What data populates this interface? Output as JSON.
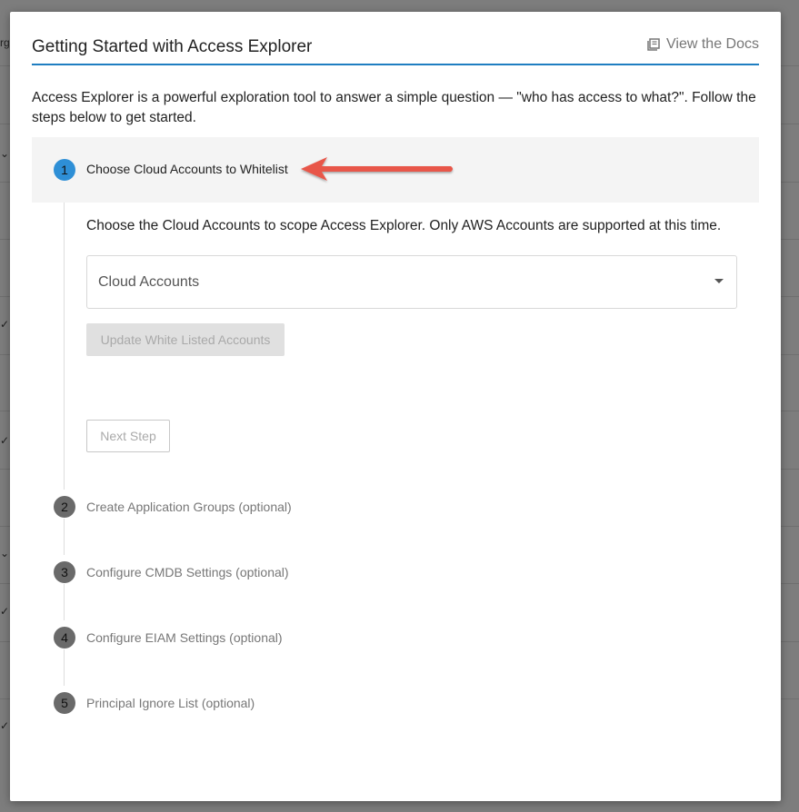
{
  "modal": {
    "title": "Getting Started with Access Explorer",
    "docs_link": "View the Docs",
    "intro": "Access Explorer is a powerful exploration tool to answer a simple question — \"who has access to what?\". Follow the steps below to get started."
  },
  "steps": [
    {
      "number": "1",
      "label": "Choose Cloud Accounts to Whitelist",
      "active": true
    },
    {
      "number": "2",
      "label": "Create Application Groups (optional)",
      "active": false
    },
    {
      "number": "3",
      "label": "Configure CMDB Settings (optional)",
      "active": false
    },
    {
      "number": "4",
      "label": "Configure EIAM Settings (optional)",
      "active": false
    },
    {
      "number": "5",
      "label": "Principal Ignore List (optional)",
      "active": false
    }
  ],
  "step1": {
    "description": "Choose the Cloud Accounts to scope Access Explorer. Only AWS Accounts are supported at this time.",
    "select_placeholder": "Cloud Accounts",
    "update_button": "Update White Listed Accounts",
    "next_button": "Next Step"
  },
  "background": {
    "fragment": "rg"
  },
  "colors": {
    "accent": "#1f7ec1",
    "active_step": "#2e8fd6",
    "inactive_step": "#6a6a6a",
    "annotation_arrow": "#e8574a"
  }
}
